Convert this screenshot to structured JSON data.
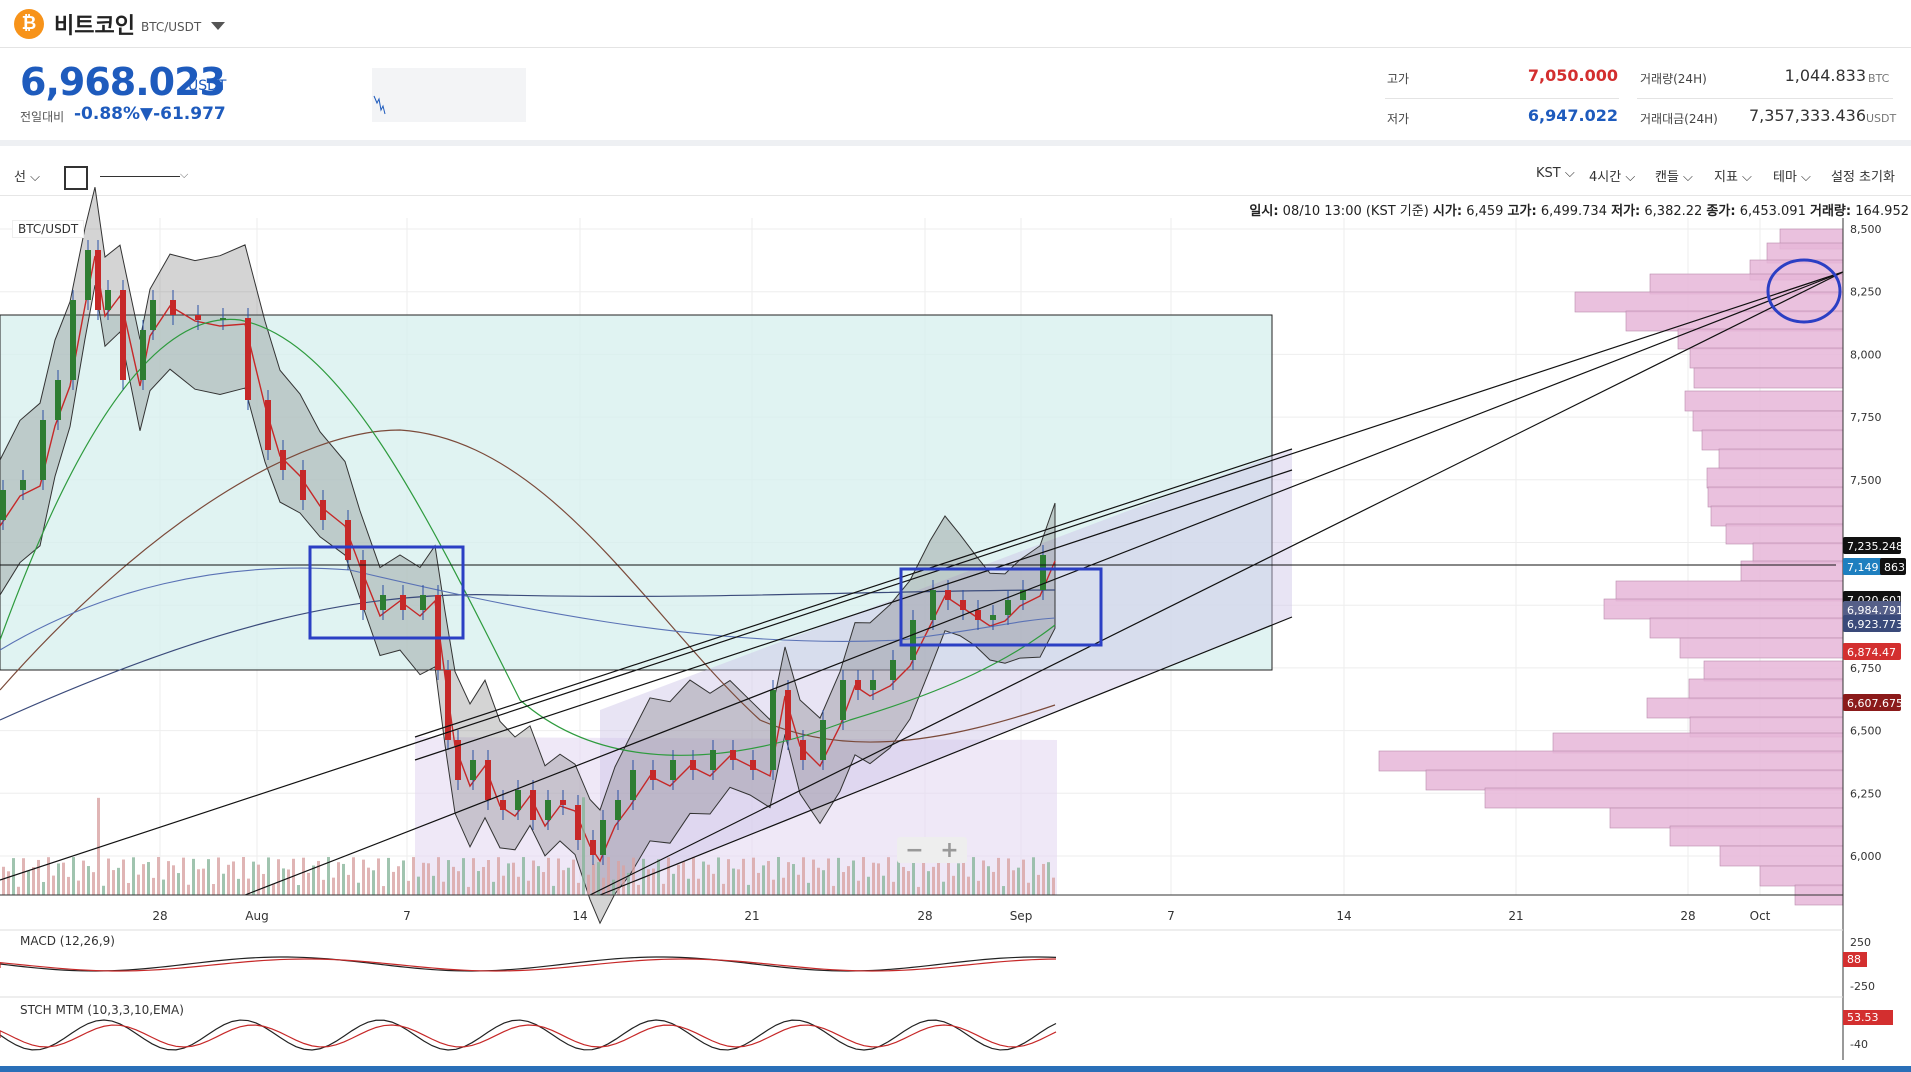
{
  "header": {
    "coin_name": "비트코인",
    "pair": "BTC/USDT",
    "logo_glyph": "₿",
    "logo_color": "#f7931a"
  },
  "price": {
    "last": "6,968.023",
    "unit": "USDT",
    "change_label": "전일대비",
    "change_pct": "-0.88%",
    "change_abs": "▼-61.977"
  },
  "stats": {
    "high_label": "고가",
    "high": "7,050.000",
    "low_label": "저가",
    "low": "6,947.022",
    "volume_label": "거래량(24H)",
    "volume": "1,044.833",
    "volume_unit": "BTC",
    "amount_label": "거래대금(24H)",
    "amount": "7,357,333.436",
    "amount_unit": "USDT",
    "high_color": "#d32f2f",
    "low_color": "#1e5bbd"
  },
  "toolbar": {
    "line_label": "선 ⌵",
    "timezone": "KST ⌵",
    "interval": "4시간 ⌵",
    "candle": "캔들 ⌵",
    "indicator": "지표 ⌵",
    "theme": "테마 ⌵",
    "reset": "설정 초기화"
  },
  "ohlc_info": {
    "date_label": "일시:",
    "date": "08/10 13:00 (KST 기준)",
    "open_label": "시가:",
    "open": "6,459",
    "high_label": "고가:",
    "high": "6,499.734",
    "low_label": "저가:",
    "low": "6,382.22",
    "close_label": "종가:",
    "close": "6,453.091",
    "vol_label": "거래량:",
    "vol": "164.952"
  },
  "chart": {
    "pair_tag": "BTC/USDT",
    "macd_label": "MACD (12,26,9)",
    "stch_label": "STCH MTM (10,3,3,10,EMA)",
    "x_ticks": [
      "28",
      "Aug",
      "7",
      "14",
      "21",
      "28",
      "Sep",
      "7",
      "14",
      "21",
      "28",
      "Oct"
    ],
    "y_ticks": [
      "8,500",
      "8,250",
      "8,000",
      "7,750",
      "7,500",
      "7,250",
      "7,000",
      "6,750",
      "6,500",
      "6,250",
      "6,000"
    ],
    "macd_ticks": [
      "250",
      "-250"
    ],
    "stch_ticks": [
      "-40"
    ],
    "price_tags": [
      {
        "text": "7,235.248",
        "bg": "#111111"
      },
      {
        "text": "7,149",
        "bg": "#1e7fbf"
      },
      {
        "text": "863",
        "bg": "#111111"
      },
      {
        "text": "7,020.601",
        "bg": "#111111"
      },
      {
        "text": "6,984.791",
        "bg": "#555f88"
      },
      {
        "text": "6,923.773",
        "bg": "#3a4a7a"
      },
      {
        "text": "6,874.47",
        "bg": "#d32f2f"
      },
      {
        "text": "6,607.675",
        "bg": "#8b1a1a"
      }
    ],
    "macd_tag": "88",
    "stch_tag": "53.53"
  }
}
